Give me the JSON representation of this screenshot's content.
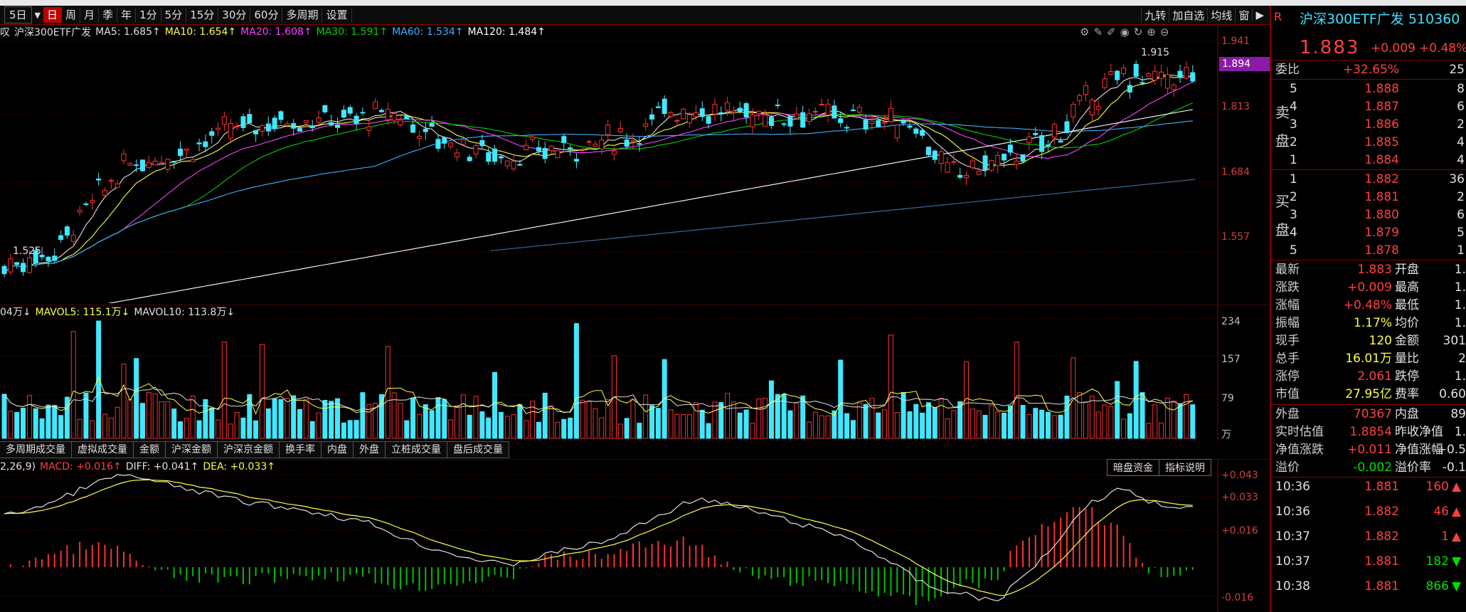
{
  "periods": {
    "dropdown": "5日",
    "items": [
      "日",
      "周",
      "月",
      "季",
      "年",
      "1分",
      "5分",
      "15分",
      "30分",
      "60分",
      "多周期",
      "设置"
    ],
    "selected": "日"
  },
  "toolbar_right": [
    "九转",
    "加自选",
    "均线",
    "窗"
  ],
  "main": {
    "left_clip": "叹",
    "name": "沪深300ETF广发",
    "ma": [
      {
        "label": "MA5: 1.685↑",
        "color": "#e0e0e0"
      },
      {
        "label": "MA10: 1.654↑",
        "color": "#ffff40"
      },
      {
        "label": "MA20: 1.608↑",
        "color": "#ff40ff"
      },
      {
        "label": "MA30: 1.591↑",
        "color": "#00d000"
      },
      {
        "label": "MA60: 1.534↑",
        "color": "#40b0ff"
      },
      {
        "label": "MA120: 1.484↑",
        "color": "#ffffff"
      }
    ],
    "axis": [
      "1.941",
      "1.813",
      "1.684",
      "1.557"
    ],
    "current_price_tag": "1.894",
    "high_label": "1.915",
    "low_label": "1.525"
  },
  "volume": {
    "label": "04万↓",
    "mavol5": "MAVOL5: 115.1万↓",
    "mavol10": "MAVOL10: 113.8万↓",
    "axis": [
      "234",
      "157",
      "79",
      "万"
    ],
    "tabs": [
      "多周期成交量",
      "虚拟成交量",
      "金额",
      "沪深金额",
      "沪深京金额",
      "换手率",
      "内盘",
      "外盘",
      "立桩成交量",
      "盘后成交量"
    ]
  },
  "macd": {
    "params": "2,26,9)",
    "macd_val": "MACD: +0.016↑",
    "diff": "DIFF: +0.041↑",
    "dea": "DEA: +0.033↑",
    "buttons": [
      "暗盘资金",
      "指标说明"
    ],
    "axis": [
      "+0.043",
      "+0.033",
      "+0.016",
      "-0.016"
    ]
  },
  "quote": {
    "title": "沪深300ETF广发 510360",
    "price": "1.883",
    "change": "+0.009",
    "pct": "+0.48%",
    "weibi_label": "委比",
    "weibi": "+32.65%",
    "weibi_extra": "25",
    "sell_label": [
      "卖",
      "盘"
    ],
    "buy_label": [
      "买",
      "盘"
    ],
    "asks": [
      {
        "lvl": "5",
        "price": "1.888",
        "vol": "8"
      },
      {
        "lvl": "4",
        "price": "1.887",
        "vol": "6"
      },
      {
        "lvl": "3",
        "price": "1.886",
        "vol": "2"
      },
      {
        "lvl": "2",
        "price": "1.885",
        "vol": "4"
      },
      {
        "lvl": "1",
        "price": "1.884",
        "vol": "4"
      }
    ],
    "bids": [
      {
        "lvl": "1",
        "price": "1.882",
        "vol": "36"
      },
      {
        "lvl": "2",
        "price": "1.881",
        "vol": "2"
      },
      {
        "lvl": "3",
        "price": "1.880",
        "vol": "6"
      },
      {
        "lvl": "4",
        "price": "1.879",
        "vol": "5"
      },
      {
        "lvl": "5",
        "price": "1.878",
        "vol": "1"
      }
    ],
    "stats": [
      {
        "l1": "最新",
        "v1": "1.883",
        "c1": "red",
        "l2": "开盘",
        "v2": "1."
      },
      {
        "l1": "涨跌",
        "v1": "+0.009",
        "c1": "red",
        "l2": "最高",
        "v2": "1."
      },
      {
        "l1": "涨幅",
        "v1": "+0.48%",
        "c1": "red",
        "l2": "最低",
        "v2": "1."
      },
      {
        "l1": "振幅",
        "v1": "1.17%",
        "c1": "yellow",
        "l2": "均价",
        "v2": "1."
      },
      {
        "l1": "现手",
        "v1": "120",
        "c1": "yellow",
        "l2": "金额",
        "v2": "301"
      },
      {
        "l1": "总手",
        "v1": "16.01万",
        "c1": "yellow",
        "l2": "量比",
        "v2": "2"
      },
      {
        "l1": "涨停",
        "v1": "2.061",
        "c1": "red",
        "l2": "跌停",
        "v2": "1."
      },
      {
        "l1": "市值",
        "v1": "27.95亿",
        "c1": "yellow",
        "l2": "费率",
        "v2": "0.60"
      }
    ],
    "stats2": [
      {
        "l1": "外盘",
        "v1": "70367",
        "c1": "red",
        "l2": "内盘",
        "v2": "89"
      },
      {
        "l1": "实时估值",
        "v1": "1.8854",
        "c1": "red",
        "l2": "昨收净值",
        "v2": "1."
      },
      {
        "l1": "净值涨跌",
        "v1": "+0.011",
        "c1": "red",
        "l2": "净值涨幅",
        "v2": "+0.5"
      },
      {
        "l1": "溢价",
        "v1": "-0.002",
        "c1": "green",
        "l2": "溢价率",
        "v2": "-0.1"
      }
    ],
    "ticks": [
      {
        "time": "10:36",
        "price": "1.881",
        "vol": "160",
        "dir": "up"
      },
      {
        "time": "10:36",
        "price": "1.882",
        "vol": "46",
        "dir": "up"
      },
      {
        "time": "10:37",
        "price": "1.882",
        "vol": "1",
        "dir": "up"
      },
      {
        "time": "10:37",
        "price": "1.881",
        "vol": "182",
        "dir": "down"
      },
      {
        "time": "10:38",
        "price": "1.881",
        "vol": "866",
        "dir": "down"
      }
    ]
  }
}
